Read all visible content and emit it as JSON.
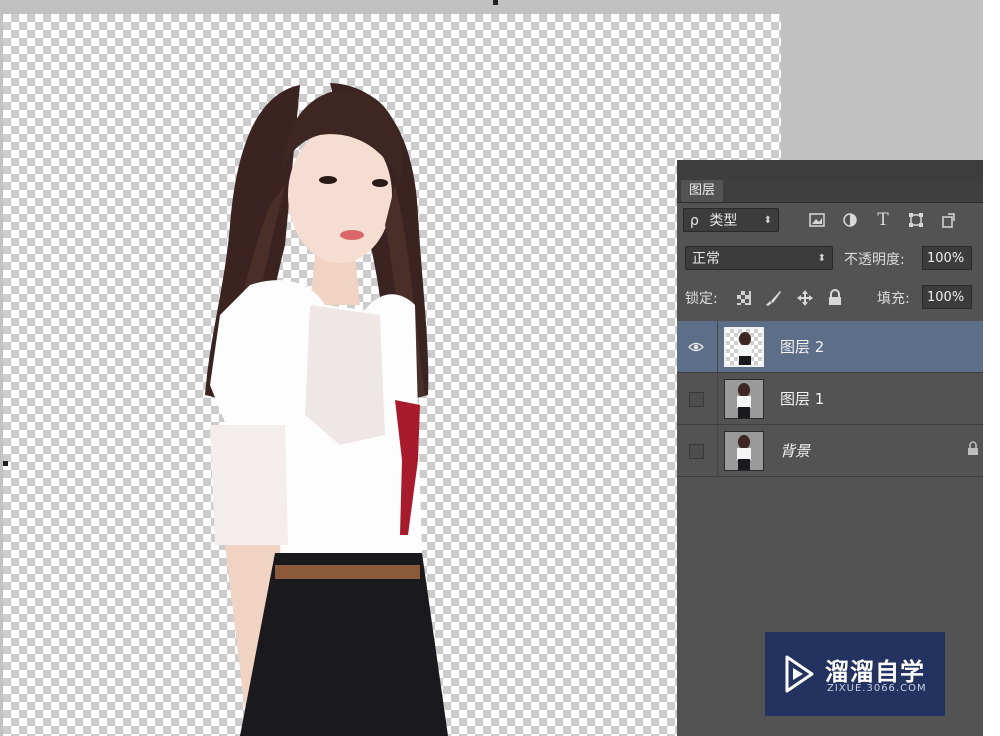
{
  "panel": {
    "tab_label": "图层",
    "filter": {
      "search_symbol": "ρ",
      "kind_label": "类型",
      "icons": [
        "image-filter-icon",
        "adjustment-filter-icon",
        "type-filter-icon",
        "shape-filter-icon",
        "smart-object-filter-icon"
      ],
      "type_glyph": "T"
    },
    "blend": {
      "mode": "正常",
      "opacity_label": "不透明度:",
      "opacity_value": "100%"
    },
    "lock": {
      "label": "锁定:",
      "icons": [
        "lock-transparent-icon",
        "lock-paint-icon",
        "lock-position-icon",
        "lock-all-icon"
      ],
      "fill_label": "填充:",
      "fill_value": "100%"
    },
    "layers": [
      {
        "name": "图层 2",
        "selected": true,
        "visible": true,
        "thumb": "transparent",
        "locked": false
      },
      {
        "name": "图层 1",
        "selected": false,
        "visible": false,
        "thumb": "photo",
        "locked": false
      },
      {
        "name": "背景",
        "selected": false,
        "visible": false,
        "thumb": "photo",
        "locked": true
      }
    ]
  },
  "watermark": {
    "brand": "溜溜自学",
    "url": "ZIXUE.3066.COM",
    "icon": "play-logo-icon"
  },
  "colors": {
    "pasteboard": "#c1c1c1",
    "panel_bg": "#535353",
    "selected_layer": "#5c6e88",
    "watermark_bg": "#23325e"
  }
}
